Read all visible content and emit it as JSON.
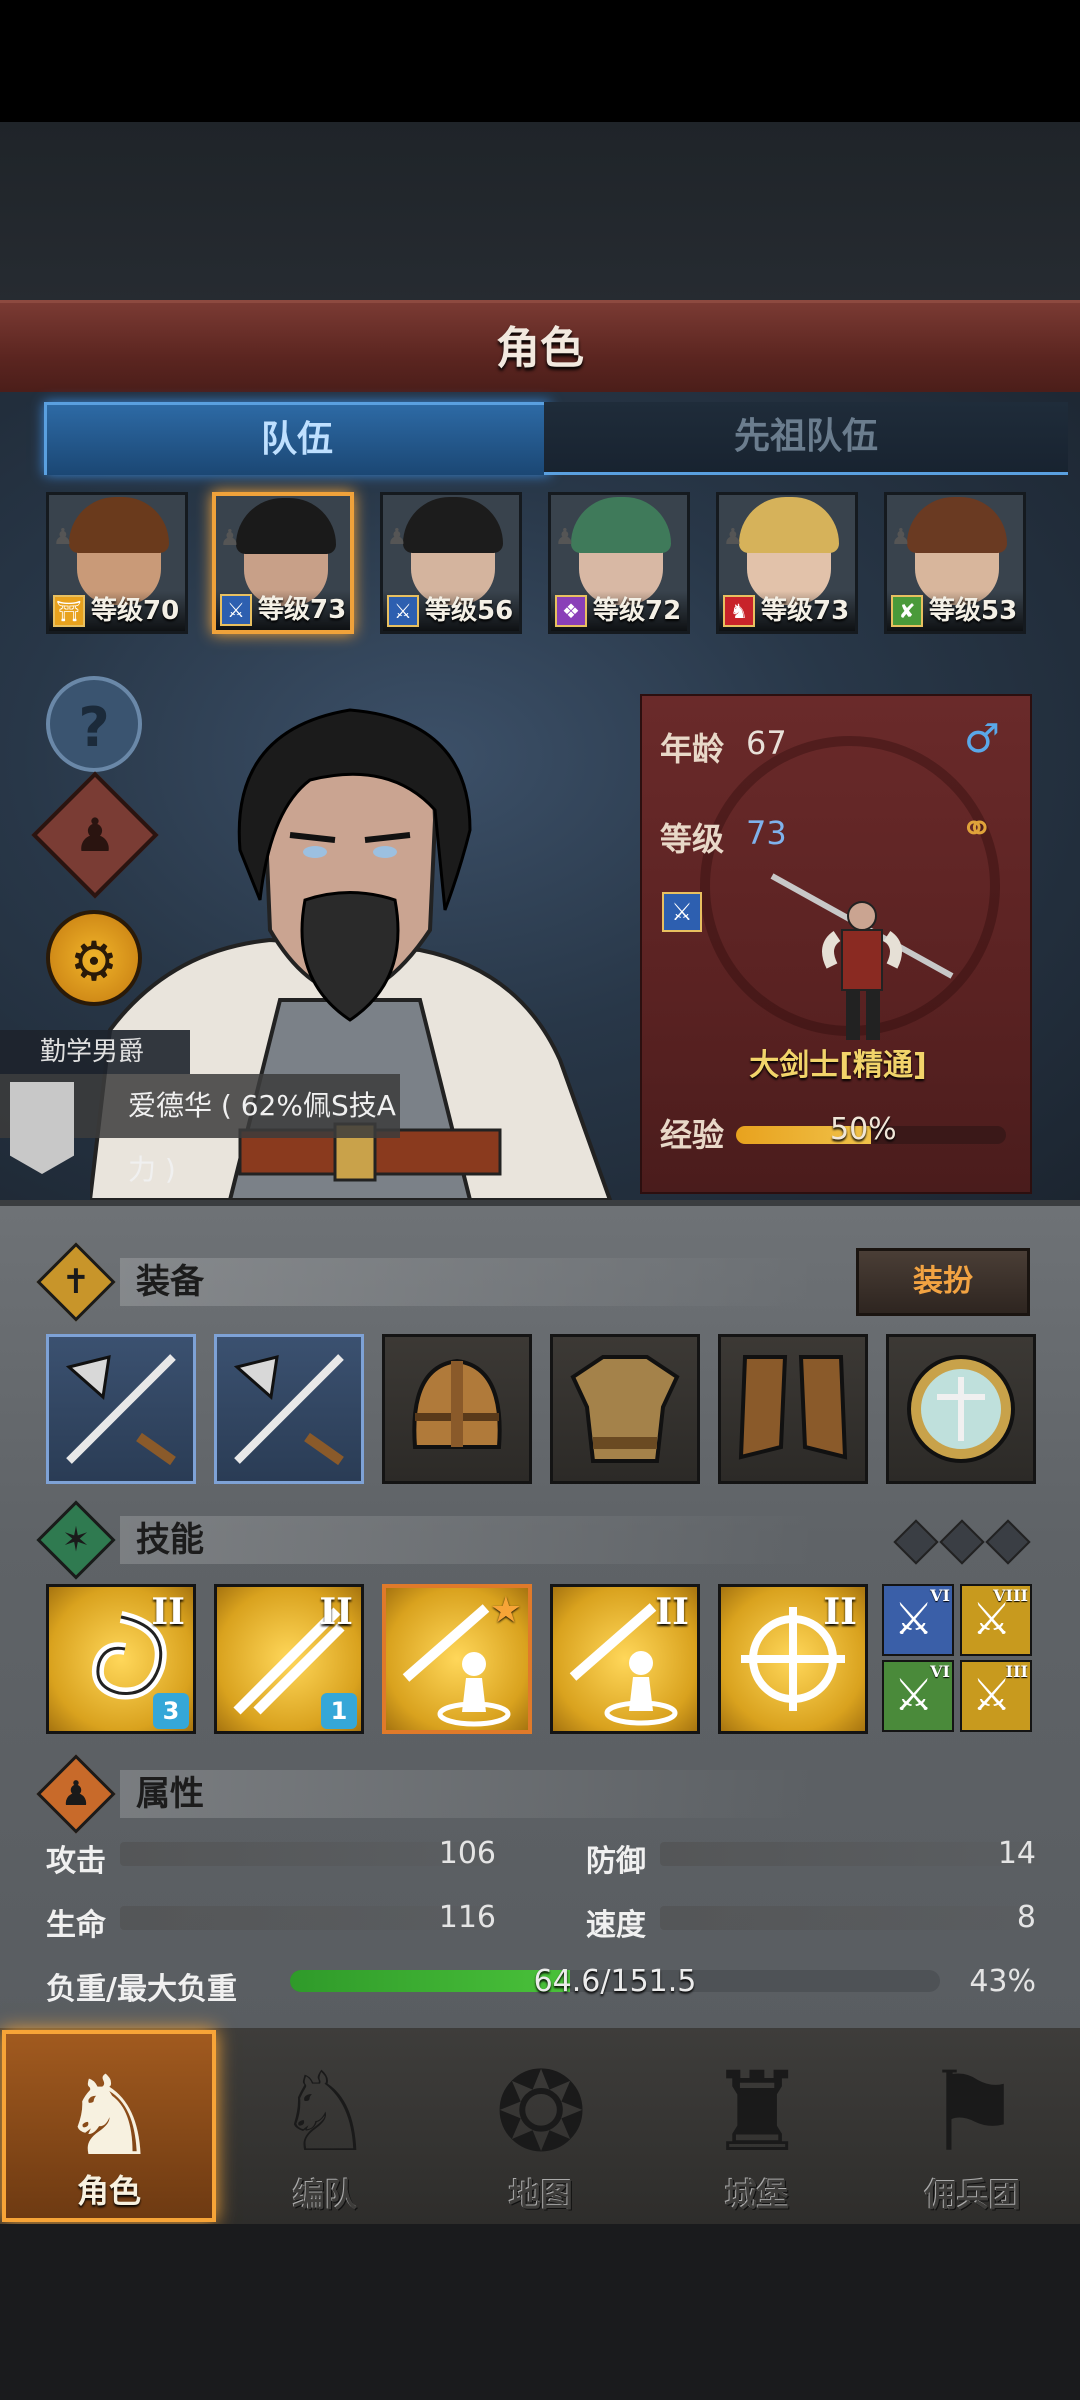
{
  "header": {
    "title": "角色"
  },
  "tabs": [
    {
      "label": "队伍",
      "active": true
    },
    {
      "label": "先祖队伍",
      "active": false
    }
  ],
  "party": [
    {
      "level": "等级70",
      "class_icon": "shield-icon",
      "class_color": "#e8a21e",
      "selected": false,
      "hair": "#6a3a1c",
      "skin": "#c99a78"
    },
    {
      "level": "等级73",
      "class_icon": "greatsword-icon",
      "class_color": "#2d5fb0",
      "selected": true,
      "hair": "#1a1a1a",
      "skin": "#c8a088"
    },
    {
      "level": "等级56",
      "class_icon": "greatsword-icon",
      "class_color": "#2d5fb0",
      "selected": false,
      "hair": "#1c1c1c",
      "skin": "#d4b49e"
    },
    {
      "level": "等级72",
      "class_icon": "staff-icon",
      "class_color": "#8a3fb8",
      "selected": false,
      "hair": "#3f7a5a",
      "skin": "#d8b8a4"
    },
    {
      "level": "等级73",
      "class_icon": "beast-icon",
      "class_color": "#c8232a",
      "selected": false,
      "hair": "#d6b25a",
      "skin": "#e2c2aa"
    },
    {
      "level": "等级53",
      "class_icon": "crossbow-icon",
      "class_color": "#4a9a3a",
      "selected": false,
      "hair": "#6a3a22",
      "skin": "#d8b69c"
    }
  ],
  "hero": {
    "title": "勤学男爵",
    "trait": "爱德华 ( 62%佩S技A力 )",
    "age_label": "年龄",
    "age": "67",
    "level_label": "等级",
    "level": "73",
    "gender_icon": "male-icon",
    "class_name": "大剑士[精通]",
    "exp_label": "经验",
    "exp_text": "50%",
    "exp_fraction": 0.5
  },
  "equipment": {
    "label": "装备",
    "dress_button": "装扮",
    "slots": [
      {
        "icon": "halberd-icon",
        "type": "weapon"
      },
      {
        "icon": "halberd-icon",
        "type": "weapon"
      },
      {
        "icon": "helmet-icon",
        "type": "armor"
      },
      {
        "icon": "armor-icon",
        "type": "armor"
      },
      {
        "icon": "boots-icon",
        "type": "armor"
      },
      {
        "icon": "amulet-icon",
        "type": "armor"
      }
    ]
  },
  "skills": {
    "label": "技能",
    "items": [
      {
        "icon": "whirlwind-skill-icon",
        "rank": "II",
        "badge": "3"
      },
      {
        "icon": "slash-skill-icon",
        "rank": "II",
        "badge": "1"
      },
      {
        "icon": "sword-stance-skill-icon",
        "rank": "",
        "badge": "",
        "star": true
      },
      {
        "icon": "sword-stance-skill-icon",
        "rank": "II",
        "badge": ""
      },
      {
        "icon": "target-skill-icon",
        "rank": "II",
        "badge": ""
      }
    ],
    "passives": [
      {
        "icon": "crossed-swords-icon",
        "rank": "VI",
        "color": "#3a5fa8"
      },
      {
        "icon": "crossed-swords-icon",
        "rank": "VIII",
        "color": "#c89a1e"
      },
      {
        "icon": "burst-icon",
        "rank": "VI",
        "color": "#4a8a3a"
      },
      {
        "icon": "gauntlet-icon",
        "rank": "III",
        "color": "#c89a1e"
      }
    ]
  },
  "attributes": {
    "label": "属性",
    "attack_label": "攻击",
    "attack": "106",
    "defense_label": "防御",
    "defense": "14",
    "hp_label": "生命",
    "hp": "116",
    "speed_label": "速度",
    "speed": "8",
    "load_label": "负重/最大负重",
    "load": "64.6/151.5",
    "load_pct": "43%",
    "load_fraction": 0.43
  },
  "nav": [
    {
      "label": "角色",
      "icon": "knight-icon",
      "active": true
    },
    {
      "label": "编队",
      "icon": "helmet-icon",
      "active": false
    },
    {
      "label": "地图",
      "icon": "compass-icon",
      "active": false
    },
    {
      "label": "城堡",
      "icon": "castle-icon",
      "active": false
    },
    {
      "label": "佣兵团",
      "icon": "banner-icon",
      "active": false
    }
  ],
  "colors": {
    "accent": "#f7a437",
    "tab_blue": "#5aa0e0",
    "panel_red": "#5a2222"
  }
}
